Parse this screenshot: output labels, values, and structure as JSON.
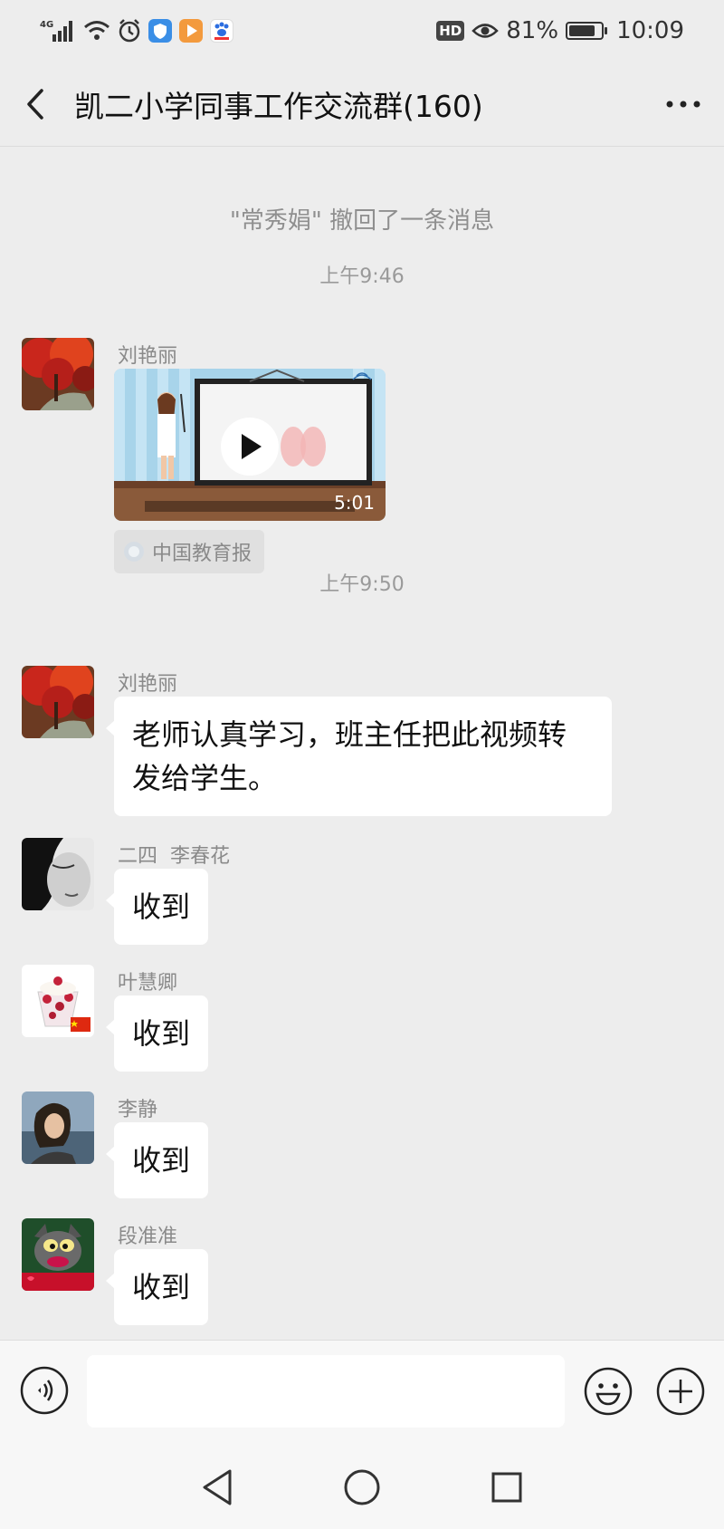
{
  "status_bar": {
    "network": "4G",
    "battery": "81%",
    "battery_level": 0.81,
    "time": "10:09",
    "hd_label": "HD",
    "icons": [
      "signal-icon",
      "wifi-icon",
      "alarm-icon",
      "shield-app-icon",
      "video-app-icon",
      "baidu-app-icon",
      "hd-icon",
      "eye-icon",
      "battery-icon"
    ]
  },
  "header": {
    "title": "凯二小学同事工作交流群(160)",
    "back_icon": "chevron-left-icon",
    "more_icon": "more-dots-icon"
  },
  "chat": {
    "recall_notice": "\"常秀娟\" 撤回了一条消息",
    "messages": [
      {
        "type": "time",
        "text": "上午9:46"
      },
      {
        "type": "video",
        "sender": "刘艳丽",
        "duration": "5:01",
        "source": "中国教育报"
      },
      {
        "type": "time",
        "text": "上午9:50"
      },
      {
        "type": "text",
        "sender": "刘艳丽",
        "text": "老师认真学习，班主任把此视频转发给学生。"
      },
      {
        "type": "text",
        "sender": "二四  李春花",
        "text": "收到"
      },
      {
        "type": "text",
        "sender": "叶慧卿",
        "text": "收到"
      },
      {
        "type": "text",
        "sender": "李静",
        "text": "收到"
      },
      {
        "type": "text",
        "sender": "段准准",
        "text": "收到"
      }
    ]
  },
  "input_bar": {
    "placeholder": "",
    "icons": [
      "voice-icon",
      "emoji-icon",
      "plus-icon"
    ]
  },
  "nav_bar": {
    "icons": [
      "back-triangle-icon",
      "home-circle-icon",
      "recents-square-icon"
    ]
  },
  "colors": {
    "background": "#ededed",
    "bubble": "#ffffff",
    "muted_text": "#8a8a8a"
  }
}
